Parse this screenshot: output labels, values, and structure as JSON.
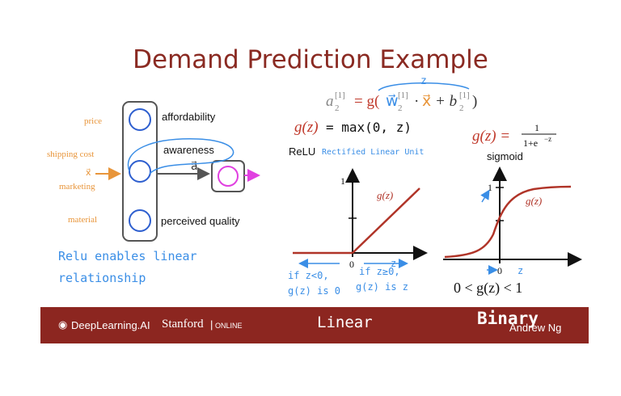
{
  "slide": {
    "title": "Demand Prediction Example"
  },
  "network": {
    "inputs": [
      "price",
      "shipping cost",
      "marketing",
      "material"
    ],
    "input_vector": "x⃗",
    "hidden_units": [
      "affordability",
      "awareness",
      "perceived quality"
    ],
    "output_label": "a⃗"
  },
  "formulas": {
    "main_lhs": "a",
    "main_sup": "[1]",
    "main_sub": "2",
    "main_eq": "= g(",
    "main_w": "w⃗",
    "main_w_sup": "[1]",
    "main_w_sub": "2",
    "main_dot": "·",
    "main_x": "x⃗",
    "main_plus": "+ b",
    "main_b_sup": "[1]",
    "main_b_sub": "2",
    "main_close": ")",
    "z_annot": "z",
    "relu_def_g": "g(z)",
    "relu_def_rhs": "= max(0, z)",
    "relu_name": "ReLU",
    "relu_full": "Rectified Linear Unit",
    "sigmoid_lhs": "g(z) =",
    "sigmoid_num": "1",
    "sigmoid_den": "1+e",
    "sigmoid_exp": "−z",
    "sigmoid_name": "sigmoid",
    "sigmoid_range": "0 < g(z) < 1"
  },
  "relu_graph": {
    "curve_label": "g(z)",
    "y_tick": "1",
    "origin": "0",
    "x_label": "z",
    "note_left_1": "if z<0,",
    "note_left_2": "g(z) is 0",
    "note_right_1": "if z≥0,",
    "note_right_2": "g(z) is z"
  },
  "sigmoid_graph": {
    "curve_label": "g(z)",
    "y_tick": "1",
    "origin": "0",
    "x_label": "z"
  },
  "handwritten": {
    "note_1": "Relu enables linear",
    "note_2": "relationship",
    "linear": "Linear",
    "binary": "Binary"
  },
  "footer": {
    "brand": "DeepLearning.AI",
    "stanford": "Stanford",
    "online": "ONLINE",
    "author": "Andrew Ng"
  },
  "colors": {
    "title": "#8a2a22",
    "footer_bg": "#8c2620",
    "input_label": "#e8953a",
    "pen_blue": "#3a8ee6",
    "curve_red": "#b03428",
    "output_magenta": "#e040e0"
  }
}
